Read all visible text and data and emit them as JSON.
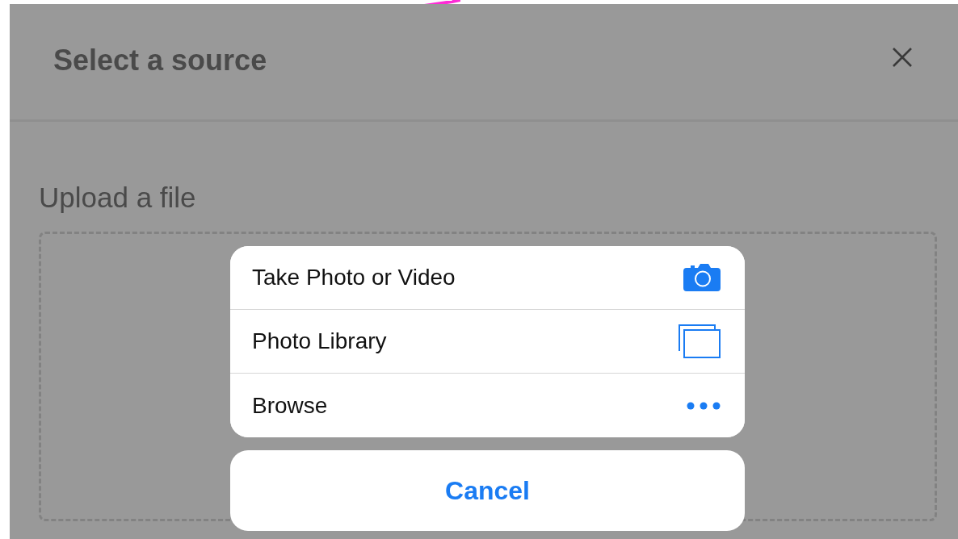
{
  "modal": {
    "title": "Select a source",
    "section_label": "Upload a file"
  },
  "action_sheet": {
    "actions": [
      {
        "label": "Take Photo or Video",
        "kind": "camera"
      },
      {
        "label": "Photo Library",
        "kind": "library"
      },
      {
        "label": "Browse",
        "kind": "more"
      }
    ],
    "cancel": "Cancel"
  }
}
